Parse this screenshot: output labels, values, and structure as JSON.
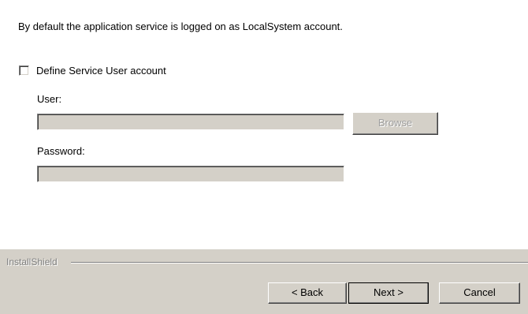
{
  "description": "By default the application service is logged on as LocalSystem account.",
  "service_account": {
    "checkbox_label": "Define Service User account",
    "checked": false,
    "user_label": "User:",
    "user_value": "",
    "browse_label": "Browse",
    "password_label": "Password:",
    "password_value": ""
  },
  "footer": {
    "brand": "InstallShield",
    "back_label": "< Back",
    "next_label": "Next >",
    "cancel_label": "Cancel"
  }
}
